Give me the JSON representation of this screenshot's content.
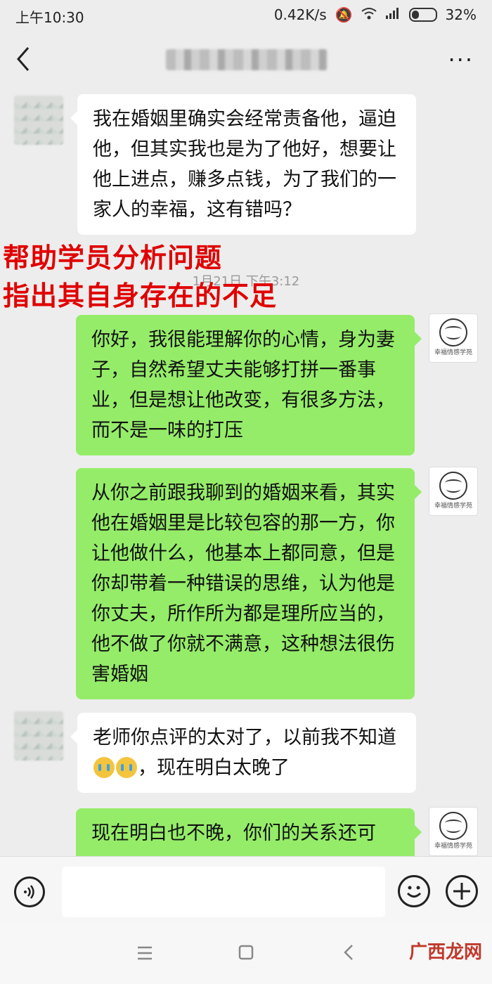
{
  "status_bar": {
    "time": "上午10:30",
    "network_speed": "0.42K/s",
    "battery": "32%",
    "icons": [
      "mute-icon",
      "wifi-icon",
      "signal-icon",
      "battery-icon"
    ]
  },
  "nav": {
    "back_glyph": "‹",
    "title_blurred": true,
    "more_glyph": "···"
  },
  "messages": [
    {
      "side": "left",
      "text": "我在婚姻里确实会经常责备他，逼迫他，但其实我也是为了他好，想要让他上进点，赚多点钱，为了我们的一家人的幸福，这有错吗？"
    },
    {
      "side": "right",
      "text": "你好，我很能理解你的心情，身为妻子，自然希望丈夫能够打拼一番事业，但是想让他改变，有很多方法，而不是一味的打压"
    },
    {
      "side": "right",
      "text": "从你之前跟我聊到的婚姻来看，其实他在婚姻里是比较包容的那一方，你让他做什么，他基本上都同意，但是你却带着一种错误的思维，认为他是你丈夫，所作所为都是理所应当的，他不做了你就不满意，这种想法很伤害婚姻"
    },
    {
      "side": "left",
      "text_before": "老师你点评的太对了，以前我不知道",
      "text_after": "，现在明白太晚了"
    },
    {
      "side": "right",
      "text": "现在明白也不晚，你们的关系还可"
    }
  ],
  "timestamp": "1月21日 下午3:12",
  "overlay": {
    "line1": "帮助学员分析问题",
    "line2": "指出其自身存在的不足",
    "color": "#e00000"
  },
  "logo_text": "幸福情感学苑",
  "input_bar": {
    "placeholder": ""
  },
  "watermark": "广西龙网",
  "colors": {
    "sent_bubble": "#95ec69",
    "received_bubble": "#ffffff",
    "background": "#ededed"
  }
}
